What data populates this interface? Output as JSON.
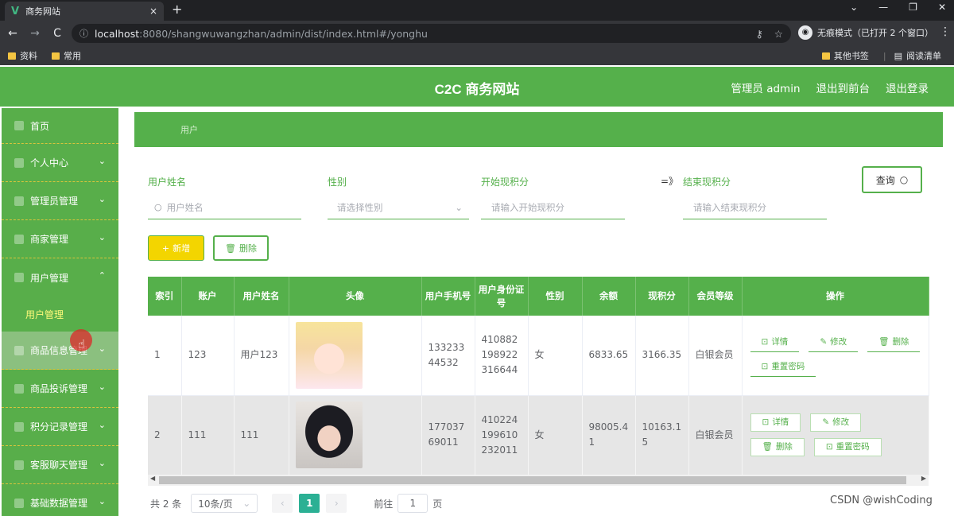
{
  "browser": {
    "tab_title": "商务网站",
    "tab_close": "×",
    "new_tab": "+",
    "window_controls": [
      "⌄",
      "—",
      "❐",
      "✕"
    ],
    "url_host": "localhost",
    "url_path": ":8080/shangwuwangzhan/admin/dist/index.html#/yonghu",
    "incognito_label": "无痕模式（已打开 2 个窗口）",
    "bookmarks": [
      "资料",
      "常用"
    ],
    "bookmarks_right": [
      "其他书签",
      "阅读清单"
    ]
  },
  "header": {
    "title": "C2C 商务网站",
    "admin_label": "管理员 admin",
    "to_front": "退出到前台",
    "logout": "退出登录"
  },
  "sidebar": {
    "items": [
      {
        "label": "首页"
      },
      {
        "label": "个人中心"
      },
      {
        "label": "管理员管理"
      },
      {
        "label": "商家管理"
      },
      {
        "label": "用户管理"
      },
      {
        "label": "用户管理"
      },
      {
        "label": "商品信息管理"
      },
      {
        "label": "商品投诉管理"
      },
      {
        "label": "积分记录管理"
      },
      {
        "label": "客服聊天管理"
      },
      {
        "label": "基础数据管理"
      }
    ]
  },
  "breadcrumb": "用户",
  "search": {
    "name_label": "用户姓名",
    "name_placeholder": "用户姓名",
    "gender_label": "性别",
    "gender_placeholder": "请选择性别",
    "start_label": "开始现积分",
    "start_placeholder": "请输入开始现积分",
    "separator": "=》",
    "end_label": "结束现积分",
    "end_placeholder": "请输入结束现积分",
    "query_button": "查询"
  },
  "actions": {
    "add": "新增",
    "delete": "删除"
  },
  "table": {
    "headers": [
      "索引",
      "账户",
      "用户姓名",
      "头像",
      "用户手机号",
      "用户身份证号",
      "性别",
      "余额",
      "现积分",
      "会员等级",
      "操作"
    ],
    "rows": [
      {
        "index": "1",
        "account": "123",
        "name": "用户123",
        "phone": "13323344532",
        "id_card": "410882198922316644",
        "gender": "女",
        "balance": "6833.65",
        "points": "3166.35",
        "level": "白银会员"
      },
      {
        "index": "2",
        "account": "111",
        "name": "111",
        "phone": "17703769011",
        "id_card": "410224199610232011",
        "gender": "女",
        "balance": "98005.41",
        "points": "10163.15",
        "level": "白银会员"
      }
    ],
    "ops": {
      "detail": "详情",
      "edit": "修改",
      "delete": "删除",
      "reset": "重置密码"
    }
  },
  "pager": {
    "total": "共 2 条",
    "page_size": "10条/页",
    "current": "1",
    "goto": "前往",
    "goto_value": "1",
    "page_unit": "页"
  },
  "watermark": "CSDN @wishCoding"
}
